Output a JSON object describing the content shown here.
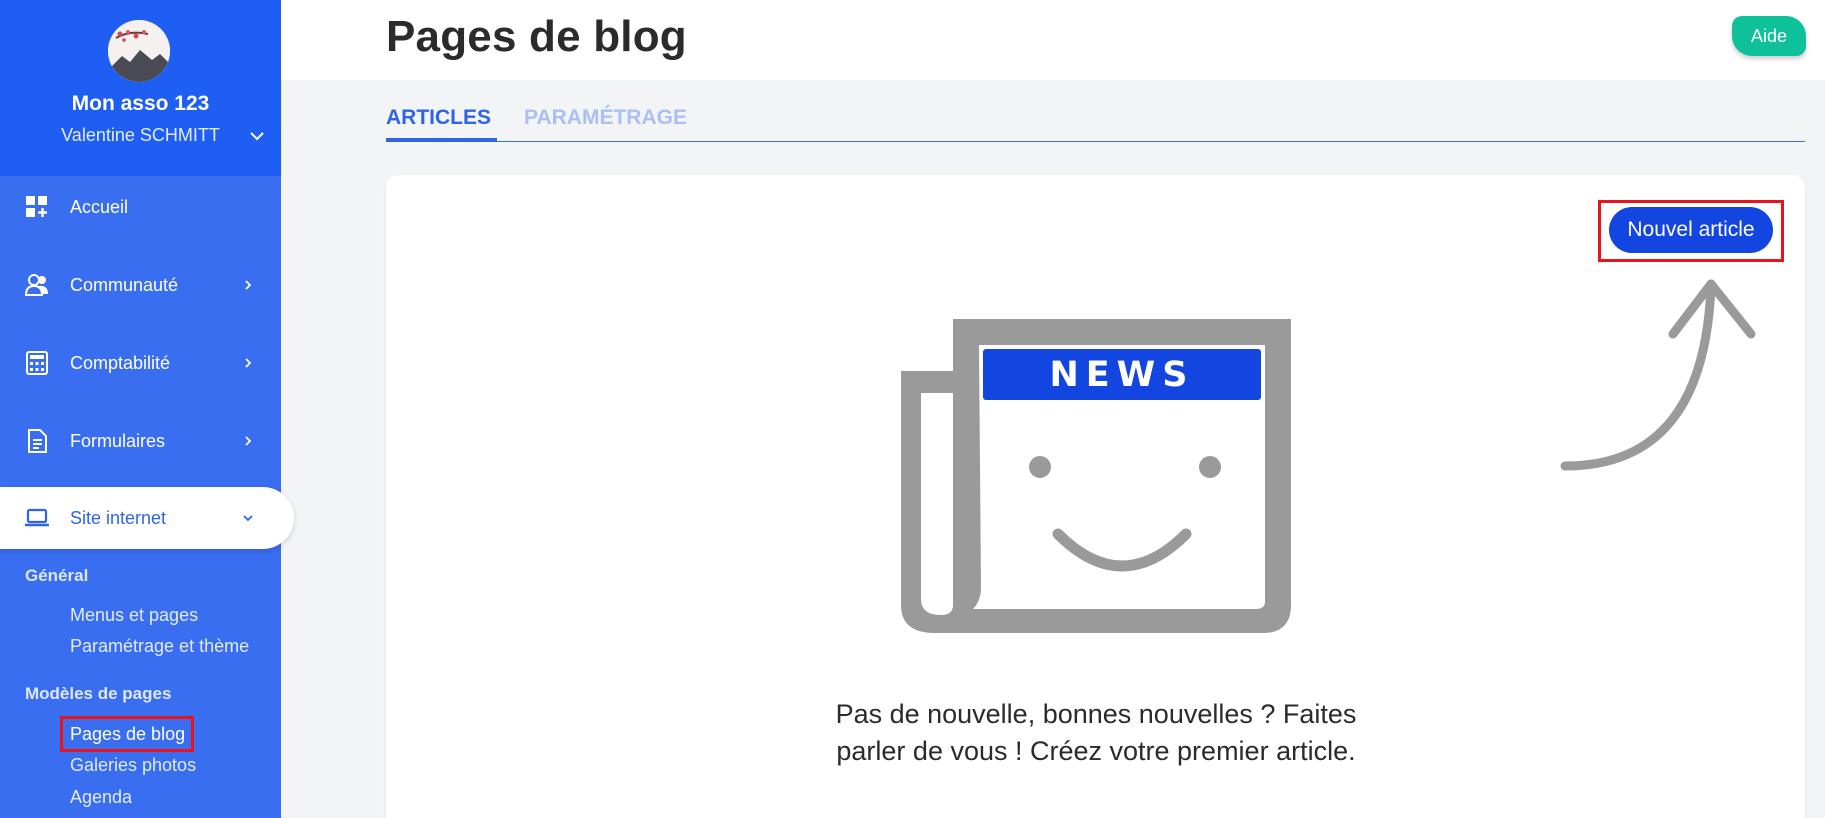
{
  "sidebar": {
    "org_name": "Mon asso 123",
    "user_name": "Valentine SCHMITT",
    "nav": [
      {
        "label": "Accueil",
        "icon": "dashboard-icon"
      },
      {
        "label": "Communauté",
        "icon": "community-icon"
      },
      {
        "label": "Comptabilité",
        "icon": "calculator-icon"
      },
      {
        "label": "Formulaires",
        "icon": "document-icon"
      },
      {
        "label": "Site internet",
        "icon": "laptop-icon",
        "active": true
      }
    ],
    "sections": [
      {
        "title": "Général",
        "links": [
          "Menus et pages",
          "Paramétrage et thème"
        ]
      },
      {
        "title": "Modèles de pages",
        "links": [
          "Pages de blog",
          "Galeries photos",
          "Agenda"
        ]
      }
    ],
    "current_link": "Pages de blog"
  },
  "header": {
    "title": "Pages de blog",
    "help_label": "Aide"
  },
  "tabs": [
    {
      "label": "ARTICLES",
      "active": true
    },
    {
      "label": "PARAMÉTRAGE",
      "active": false
    }
  ],
  "main": {
    "new_article_label": "Nouvel article",
    "illustration_text": "NEWS",
    "empty_message_line1": "Pas de nouvelle, bonnes nouvelles ? Faites",
    "empty_message_line2": "parler de vous ! Créez votre premier article."
  },
  "colors": {
    "sidebar": "#3a6ef0",
    "sidebar_header": "#1f5ef2",
    "accent": "#2f63e8",
    "primary_button": "#1346e0",
    "help_button": "#0ec19a",
    "highlight": "#e8141c",
    "illustration_gray": "#9a9a9a"
  }
}
